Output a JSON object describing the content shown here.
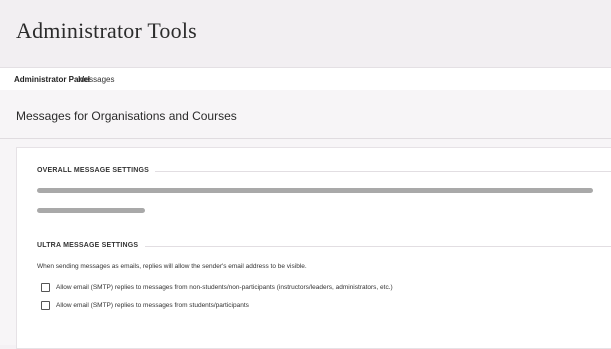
{
  "header": {
    "title": "Administrator Tools"
  },
  "breadcrumb": {
    "current": "Administrator Panel",
    "link": "Messages"
  },
  "page": {
    "heading": "Messages for Organisations and Courses"
  },
  "overall_settings": {
    "title": "OVERALL MESSAGE SETTINGS"
  },
  "ultra_settings": {
    "title": "ULTRA MESSAGE SETTINGS",
    "description": "When sending messages as emails, replies will allow the sender's email address to be visible.",
    "options": [
      {
        "label": "Allow email (SMTP) replies to messages from non-students/non-participants (instructors/leaders, administrators, etc.)",
        "checked": false
      },
      {
        "label": "Allow email (SMTP) replies to messages from students/participants",
        "checked": false
      }
    ]
  }
}
